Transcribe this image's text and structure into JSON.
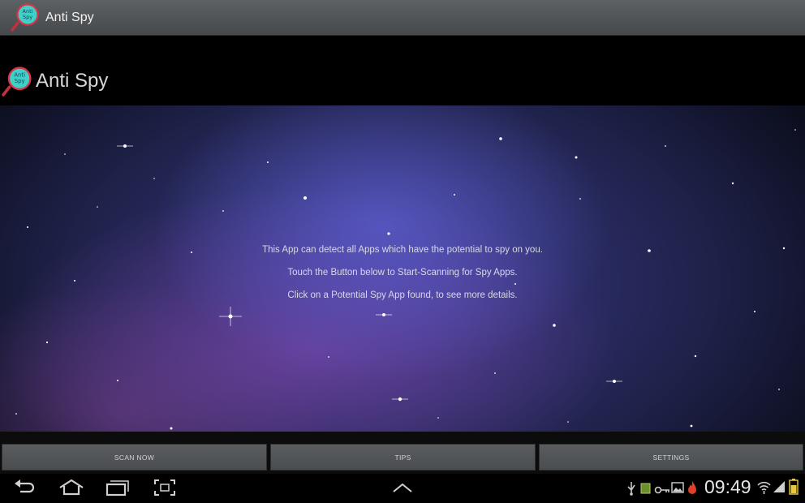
{
  "action_bar": {
    "title": "Anti Spy",
    "icon": "anti-spy-magnifier-icon"
  },
  "header": {
    "title": "Anti Spy",
    "icon": "anti-spy-magnifier-icon"
  },
  "logo_text": [
    "Anti",
    "Spy"
  ],
  "info_lines": [
    "This App can detect all Apps which have the potential to spy on you.",
    "Touch the Button below to Start-Scanning for Spy Apps.",
    "Click on a Potential Spy App found, to see more details."
  ],
  "buttons": {
    "scan": "SCAN NOW",
    "tips": "TIPS",
    "settings": "SETTINGS"
  },
  "nav_bar": {
    "icons": [
      "back-icon",
      "home-icon",
      "recent-apps-icon",
      "screenshot-icon",
      "chevron-up-icon"
    ],
    "status_icons": [
      "usb-icon",
      "sd-card-icon",
      "key-icon",
      "image-icon",
      "flame-icon",
      "wifi-icon",
      "signal-icon",
      "battery-icon"
    ],
    "time": "09:49"
  },
  "colors": {
    "action_bar": "#505456",
    "logo_teal": "#3fd0c8",
    "logo_ring": "#d8344a",
    "button_bg": "#54575a"
  }
}
